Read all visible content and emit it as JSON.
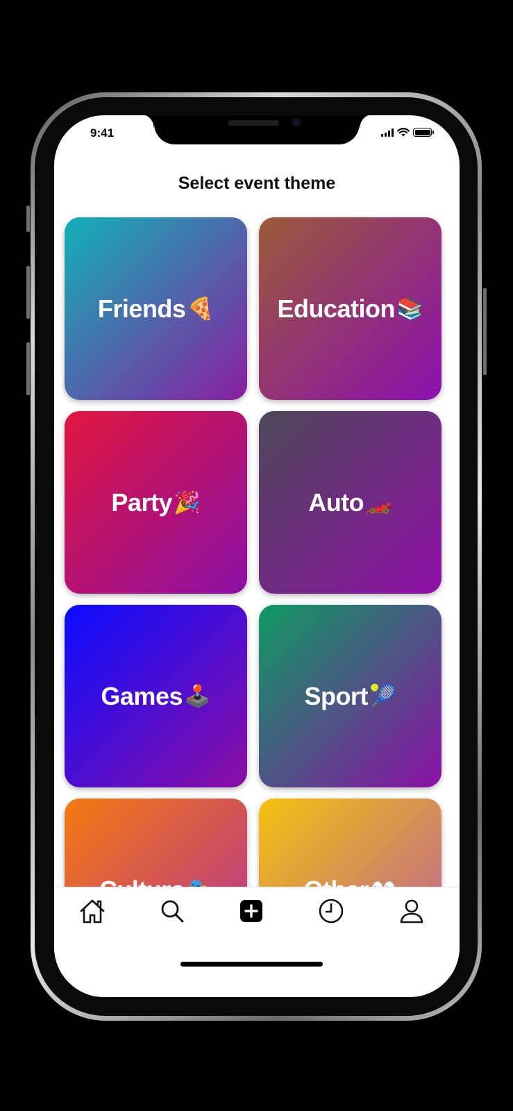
{
  "status_bar": {
    "time": "9:41"
  },
  "header": {
    "title": "Select event theme"
  },
  "themes": [
    {
      "label": "Friends",
      "emoji": "🍕",
      "gradient": [
        "#11b2b7",
        "#8a1ea0"
      ]
    },
    {
      "label": "Education",
      "emoji": "📚",
      "gradient": [
        "#9a5a38",
        "#8c0fb0"
      ]
    },
    {
      "label": "Party",
      "emoji": "🎉",
      "gradient": [
        "#e0163e",
        "#8c10a6"
      ]
    },
    {
      "label": "Auto",
      "emoji": "🏎️",
      "gradient": [
        "#4c4858",
        "#9010a8"
      ]
    },
    {
      "label": "Games",
      "emoji": "🕹️",
      "gradient": [
        "#0a0cff",
        "#8d0fa4"
      ]
    },
    {
      "label": "Sport",
      "emoji": "🎾",
      "gradient": [
        "#0e9a62",
        "#8c10a6"
      ]
    },
    {
      "label": "Culture",
      "emoji": "🎭",
      "gradient": [
        "#f57a10",
        "#b0309a"
      ]
    },
    {
      "label": "Other",
      "emoji": "👀",
      "gradient": [
        "#f4c10e",
        "#b85aa0"
      ]
    }
  ],
  "tabbar": {
    "tabs": [
      {
        "name": "home-icon"
      },
      {
        "name": "search-icon"
      },
      {
        "name": "add-icon",
        "active": true
      },
      {
        "name": "history-icon"
      },
      {
        "name": "profile-icon"
      }
    ]
  }
}
